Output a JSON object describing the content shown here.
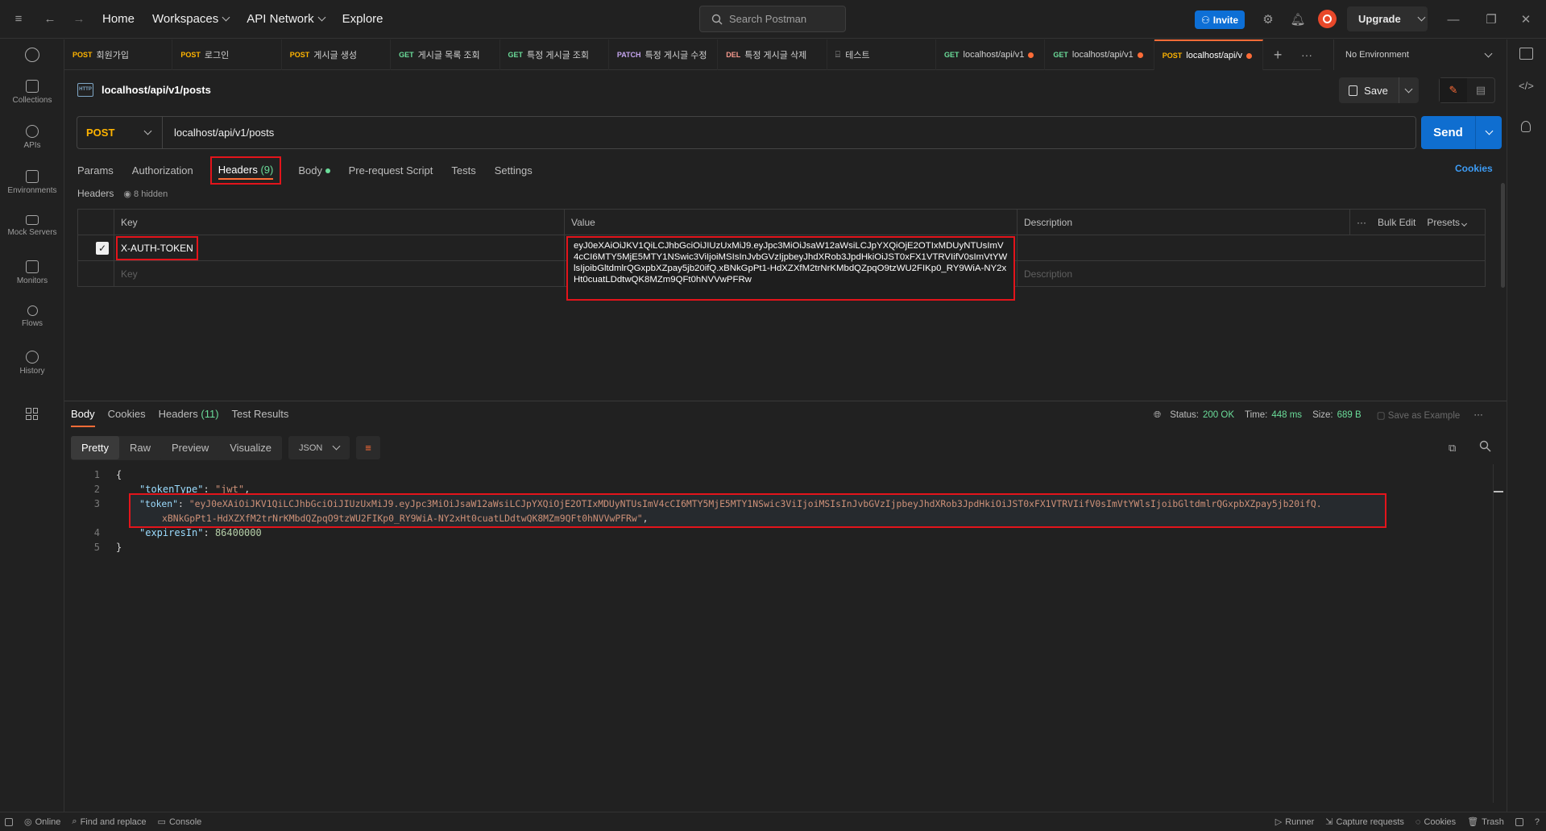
{
  "topbar": {
    "home": "Home",
    "workspaces": "Workspaces",
    "api_network": "API Network",
    "explore": "Explore",
    "search_placeholder": "Search Postman",
    "invite": "Invite",
    "upgrade": "Upgrade"
  },
  "sidebar": {
    "items": [
      {
        "label": "Collections",
        "icon": "collections-icon"
      },
      {
        "label": "APIs",
        "icon": "apis-icon"
      },
      {
        "label": "Environments",
        "icon": "environments-icon"
      },
      {
        "label": "Mock Servers",
        "icon": "mock-servers-icon"
      },
      {
        "label": "Monitors",
        "icon": "monitors-icon"
      },
      {
        "label": "Flows",
        "icon": "flows-icon"
      },
      {
        "label": "History",
        "icon": "history-icon"
      }
    ]
  },
  "tabs": [
    {
      "method": "POST",
      "label": "회원가입",
      "dot": false,
      "active": false
    },
    {
      "method": "POST",
      "label": "로그인",
      "dot": false,
      "active": false
    },
    {
      "method": "POST",
      "label": "게시글 생성",
      "dot": false,
      "active": false
    },
    {
      "method": "GET",
      "label": "게시글 목록 조회",
      "dot": false,
      "active": false
    },
    {
      "method": "GET",
      "label": "특정 게시글 조회",
      "dot": false,
      "active": false
    },
    {
      "method": "PATCH",
      "label": "특정 게시글 수정",
      "dot": false,
      "active": false
    },
    {
      "method": "DEL",
      "label": "특정 게시글 삭제",
      "dot": false,
      "active": false
    },
    {
      "method": "",
      "label": "테스트",
      "dot": false,
      "active": false
    },
    {
      "method": "GET",
      "label": "localhost/api/v1",
      "dot": true,
      "active": false
    },
    {
      "method": "GET",
      "label": "localhost/api/v1",
      "dot": true,
      "active": false
    },
    {
      "method": "POST",
      "label": "localhost/api/v",
      "dot": true,
      "active": true
    }
  ],
  "environment": "No Environment",
  "request": {
    "title": "localhost/api/v1/posts",
    "save": "Save",
    "method": "POST",
    "url": "localhost/api/v1/posts",
    "send": "Send",
    "tabs": {
      "params": "Params",
      "authorization": "Authorization",
      "headers": "Headers",
      "headers_count": "(9)",
      "body": "Body",
      "prerequest": "Pre-request Script",
      "tests": "Tests",
      "settings": "Settings"
    },
    "cookies": "Cookies",
    "headers_label": "Headers",
    "hidden": "8 hidden",
    "columns": {
      "key": "Key",
      "value": "Value",
      "description": "Description"
    },
    "bulk_edit": "Bulk Edit",
    "presets": "Presets",
    "header_row": {
      "key": "X-AUTH-TOKEN",
      "value": "eyJ0eXAiOiJKV1QiLCJhbGciOiJIUzUxMiJ9.eyJpc3MiOiJsaW12aWsiLCJpYXQiOjE2OTIxMDUyNTUsImV4cCI6MTY5MjE5MTY1NSwic3ViIjoiMSIsInJvbGVzIjpbeyJhdXRob3JpdHkiOiJST0xFX1VTRVIifV0sImVtYWlsIjoibGltdmlrQGxpbXZpay5jb20ifQ.xBNkGpPt1-HdXZXfM2trNrKMbdQZpqO9tzWU2FIKp0_RY9WiA-NY2xHt0cuatLDdtwQK8MZm9QFt0hNVVwPFRw"
    },
    "empty_row": {
      "key": "Key",
      "description": "Description"
    }
  },
  "response": {
    "tabs": {
      "body": "Body",
      "cookies": "Cookies",
      "headers": "Headers",
      "headers_count": "(11)",
      "test_results": "Test Results"
    },
    "status_label": "Status:",
    "status": "200 OK",
    "time_label": "Time:",
    "time": "448 ms",
    "size_label": "Size:",
    "size": "689 B",
    "save_example": "Save as Example",
    "views": {
      "pretty": "Pretty",
      "raw": "Raw",
      "preview": "Preview",
      "visualize": "Visualize",
      "format": "JSON"
    },
    "code": {
      "line_numbers": [
        "1",
        "2",
        "3",
        "",
        "4",
        "5"
      ],
      "open": "{",
      "token_type_key": "\"tokenType\"",
      "token_type_val": "\"jwt\"",
      "token_key": "\"token\"",
      "token_val_1": "\"eyJ0eXAiOiJKV1QiLCJhbGciOiJIUzUxMiJ9.eyJpc3MiOiJsaW12aWsiLCJpYXQiOjE2OTIxMDUyNTUsImV4cCI6MTY5MjE5MTY1NSwic3ViIjoiMSIsInJvbGVzIjpbeyJhdXRob3JpdHkiOiJST0xFX1VTRVIifV0sImVtYWlsIjoibGltdmlrQGxpbXZpay5jb20ifQ.",
      "token_val_2": "xBNkGpPt1-HdXZXfM2trNrKMbdQZpqO9tzWU2FIKp0_RY9WiA-NY2xHt0cuatLDdtwQK8MZm9QFt0hNVVwPFRw\"",
      "expires_key": "\"expiresIn\"",
      "expires_val": "86400000",
      "close": "}"
    }
  },
  "statusbar": {
    "online": "Online",
    "find_replace": "Find and replace",
    "console": "Console",
    "runner": "Runner",
    "capture": "Capture requests",
    "cookies": "Cookies",
    "trash": "Trash"
  },
  "colors": {
    "accent_orange": "#ff6c37",
    "send_blue": "#0f6ed0",
    "highlight_red": "#e3141b",
    "post": "#ffb400",
    "get": "#6bdd9a"
  }
}
